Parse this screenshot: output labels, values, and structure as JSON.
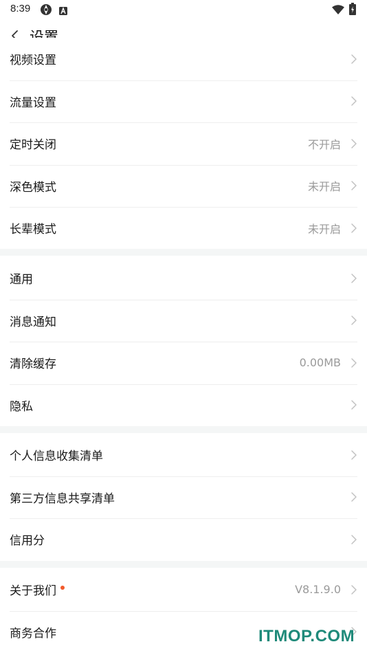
{
  "status_bar": {
    "time": "8:39",
    "icons": [
      "settings-sync-icon",
      "app-notification-icon",
      "wifi-icon",
      "battery-icon"
    ]
  },
  "header": {
    "title": "设置",
    "back_icon": "chevron-left-icon"
  },
  "sections": [
    {
      "rows": [
        {
          "label": "视频设置",
          "value": ""
        },
        {
          "label": "流量设置",
          "value": ""
        },
        {
          "label": "定时关闭",
          "value": "不开启"
        },
        {
          "label": "深色模式",
          "value": "未开启"
        },
        {
          "label": "长辈模式",
          "value": "未开启"
        }
      ]
    },
    {
      "rows": [
        {
          "label": "通用",
          "value": ""
        },
        {
          "label": "消息通知",
          "value": ""
        },
        {
          "label": "清除缓存",
          "value": "0.00MB"
        },
        {
          "label": "隐私",
          "value": ""
        }
      ]
    },
    {
      "rows": [
        {
          "label": "个人信息收集清单",
          "value": ""
        },
        {
          "label": "第三方信息共享清单",
          "value": ""
        },
        {
          "label": "信用分",
          "value": ""
        }
      ]
    },
    {
      "rows": [
        {
          "label": "关于我们",
          "value": "V8.1.9.0",
          "badge": "red-dot"
        },
        {
          "label": "商务合作",
          "value": ""
        }
      ]
    }
  ],
  "watermark": "ITMOP.COM",
  "colors": {
    "background": "#ffffff",
    "section_gap": "#f4f6f6",
    "divider": "#eeeeee",
    "secondary_text": "#9a9a9a",
    "badge": "#f25a2c",
    "watermark": "#1f8a7a"
  }
}
